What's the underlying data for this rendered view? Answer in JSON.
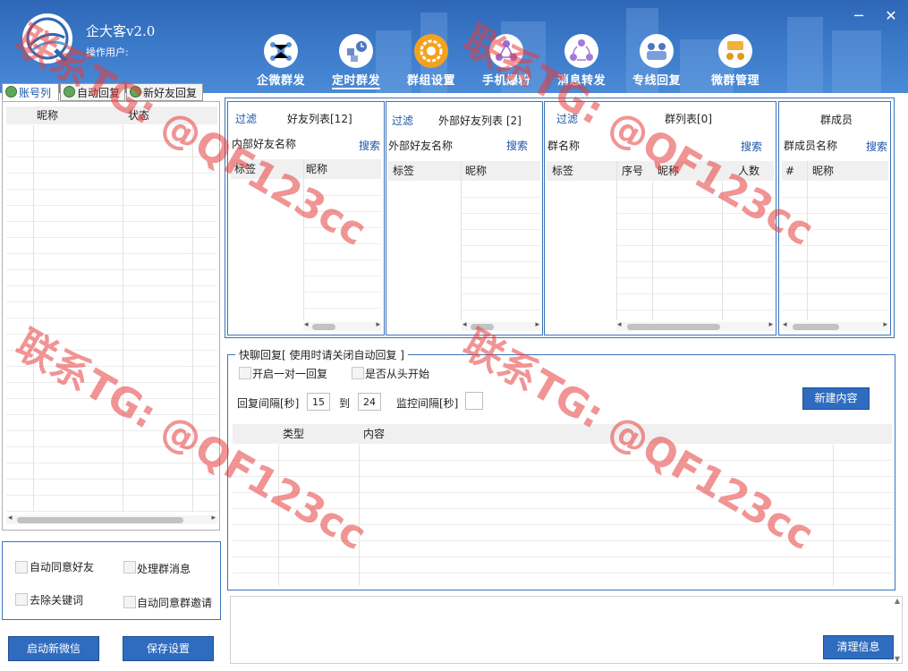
{
  "app": {
    "title": "企大客v2.0",
    "operator_label": "操作用户:"
  },
  "nav": [
    {
      "label": "企微群发",
      "icon": "share-nodes-icon"
    },
    {
      "label": "定时群发",
      "icon": "clock-boxes-icon"
    },
    {
      "label": "群组设置",
      "icon": "group-settings-icon"
    },
    {
      "label": "手机爆粉",
      "icon": "phone-network-icon"
    },
    {
      "label": "消息转发",
      "icon": "forward-cycle-icon"
    },
    {
      "label": "专线回复",
      "icon": "team-reply-icon"
    },
    {
      "label": "微群管理",
      "icon": "group-manage-icon"
    }
  ],
  "left_tabs": [
    "账号列",
    "自动回复",
    "新好友回复"
  ],
  "account_table": {
    "headers": [
      "昵称",
      "状态"
    ]
  },
  "options": {
    "auto_accept_friend": "自动同意好友",
    "handle_group_msg": "处理群消息",
    "remove_keywords": "去除关键词",
    "auto_accept_group_invite": "自动同意群邀请"
  },
  "buttons": {
    "start_wechat": "启动新微信",
    "save_settings": "保存设置",
    "new_content": "新建内容",
    "clear_info": "清理信息"
  },
  "friend_list": {
    "filter": "过滤",
    "title": "好友列表[12]",
    "search_label": "内部好友名称",
    "search": "搜索",
    "headers": [
      "标签",
      "昵称"
    ]
  },
  "external_list": {
    "filter": "过滤",
    "title": "外部好友列表 [2]",
    "search_label": "外部好友名称",
    "search": "搜索",
    "headers": [
      "标签",
      "昵称"
    ]
  },
  "group_list": {
    "filter": "过滤",
    "title": "群列表[0]",
    "search_label": "群名称",
    "search": "搜索",
    "headers": [
      "标签",
      "序号",
      "昵称",
      "人数"
    ]
  },
  "group_members": {
    "title": "群成员",
    "search_label": "群成员名称",
    "search": "搜索",
    "headers": [
      "#",
      "昵称"
    ]
  },
  "quick_reply": {
    "legend": "快聊回复[ 使用时请关闭自动回复 ]",
    "one_to_one": "开启一对一回复",
    "from_start": "是否从头开始",
    "interval_label": "回复间隔[秒]",
    "interval_from": "15",
    "to_label": "到",
    "interval_to": "24",
    "monitor_label": "监控间隔[秒]",
    "monitor_value": "",
    "headers": [
      "类型",
      "内容"
    ]
  },
  "watermark": "联系TG: @QF123cc"
}
